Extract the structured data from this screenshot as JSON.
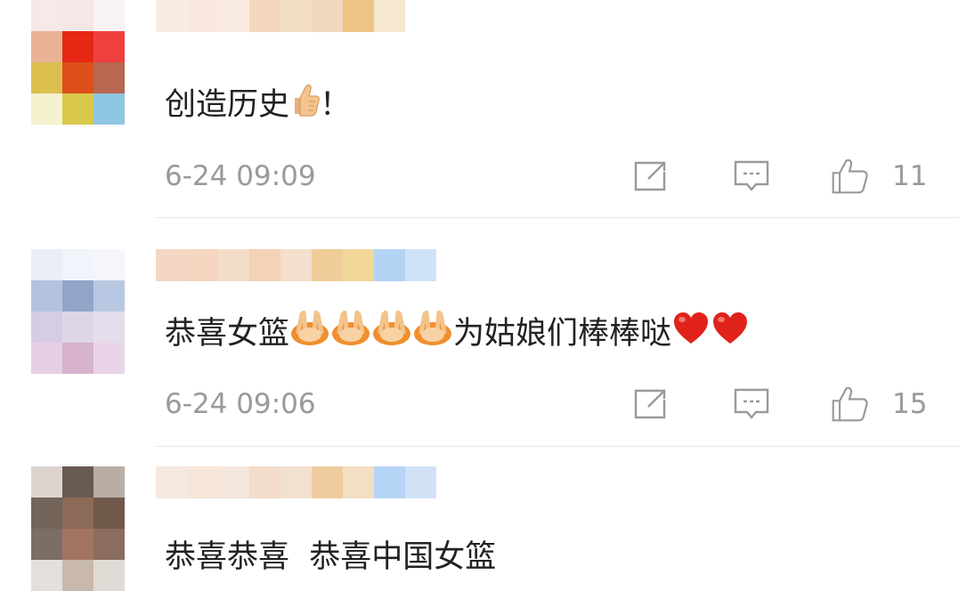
{
  "comments": [
    {
      "text": "创造历史",
      "tail": "！",
      "emojis": [
        "thumbs-up-emoji"
      ],
      "time": "6-24 09:09",
      "likes": "11",
      "avatar_pixels": [
        "#f5e9e9",
        "#f6e6e6",
        "#f9f3f3",
        "#e9b295",
        "#e52714",
        "#ef4040",
        "#dbbf4f",
        "#dc4f1a",
        "#b86750",
        "#f4f2cf",
        "#d9c849",
        "#8fc7e2"
      ],
      "name_pixels": [
        "#f8ece4",
        "#f8e8df",
        "#f9ebe0",
        "#f3d7be",
        "#f2dcc4",
        "#f3d8c1",
        "#efc585",
        "#f5e8cf"
      ]
    },
    {
      "text": "恭喜女篮",
      "tail": "为姑娘们棒棒哒",
      "emojis": [
        "victory-hand-emoji",
        "victory-hand-emoji",
        "victory-hand-emoji",
        "victory-hand-emoji",
        "red-heart-emoji",
        "red-heart-emoji"
      ],
      "time": "6-24 09:06",
      "likes": "15",
      "avatar_pixels": [
        "#e9eef7",
        "#f1f4fa",
        "#f5f6fb",
        "#b4c2de",
        "#93a4c9",
        "#b9c8e2",
        "#d6cce3",
        "#ded6e8",
        "#e5dcec",
        "#e5cfe2",
        "#d6b2cd",
        "#e9d5e7"
      ],
      "name_pixels": [
        "#f4d7c2",
        "#f5d6c0",
        "#f3dcc8",
        "#f4d2b6",
        "#f2dfcc",
        "#efcd98",
        "#f1d79a",
        "#b3d3f5",
        "#cfe3f8"
      ]
    },
    {
      "text": "恭喜恭喜  恭喜中国女篮",
      "tail": "",
      "emojis": [],
      "time": "",
      "likes": "",
      "avatar_pixels": [
        "#ddd4cf",
        "#6a5b52",
        "#b9ada5",
        "#736559",
        "#8b6a57",
        "#70584a",
        "#7b6e65",
        "#a27462",
        "#8a6d5e",
        "#e4dfdc",
        "#c9b9ac",
        "#e1dbd6"
      ],
      "name_pixels": [
        "#f5e8df",
        "#f7e6d8",
        "#f5e6dc",
        "#f3dccc",
        "#f2e0d0",
        "#efcc9e",
        "#f2dfc4",
        "#b6d4f5",
        "#d1e2f7"
      ]
    }
  ],
  "actions": {
    "share_icon": "share-icon",
    "comment_icon": "comment-icon",
    "like_icon": "like-icon"
  }
}
